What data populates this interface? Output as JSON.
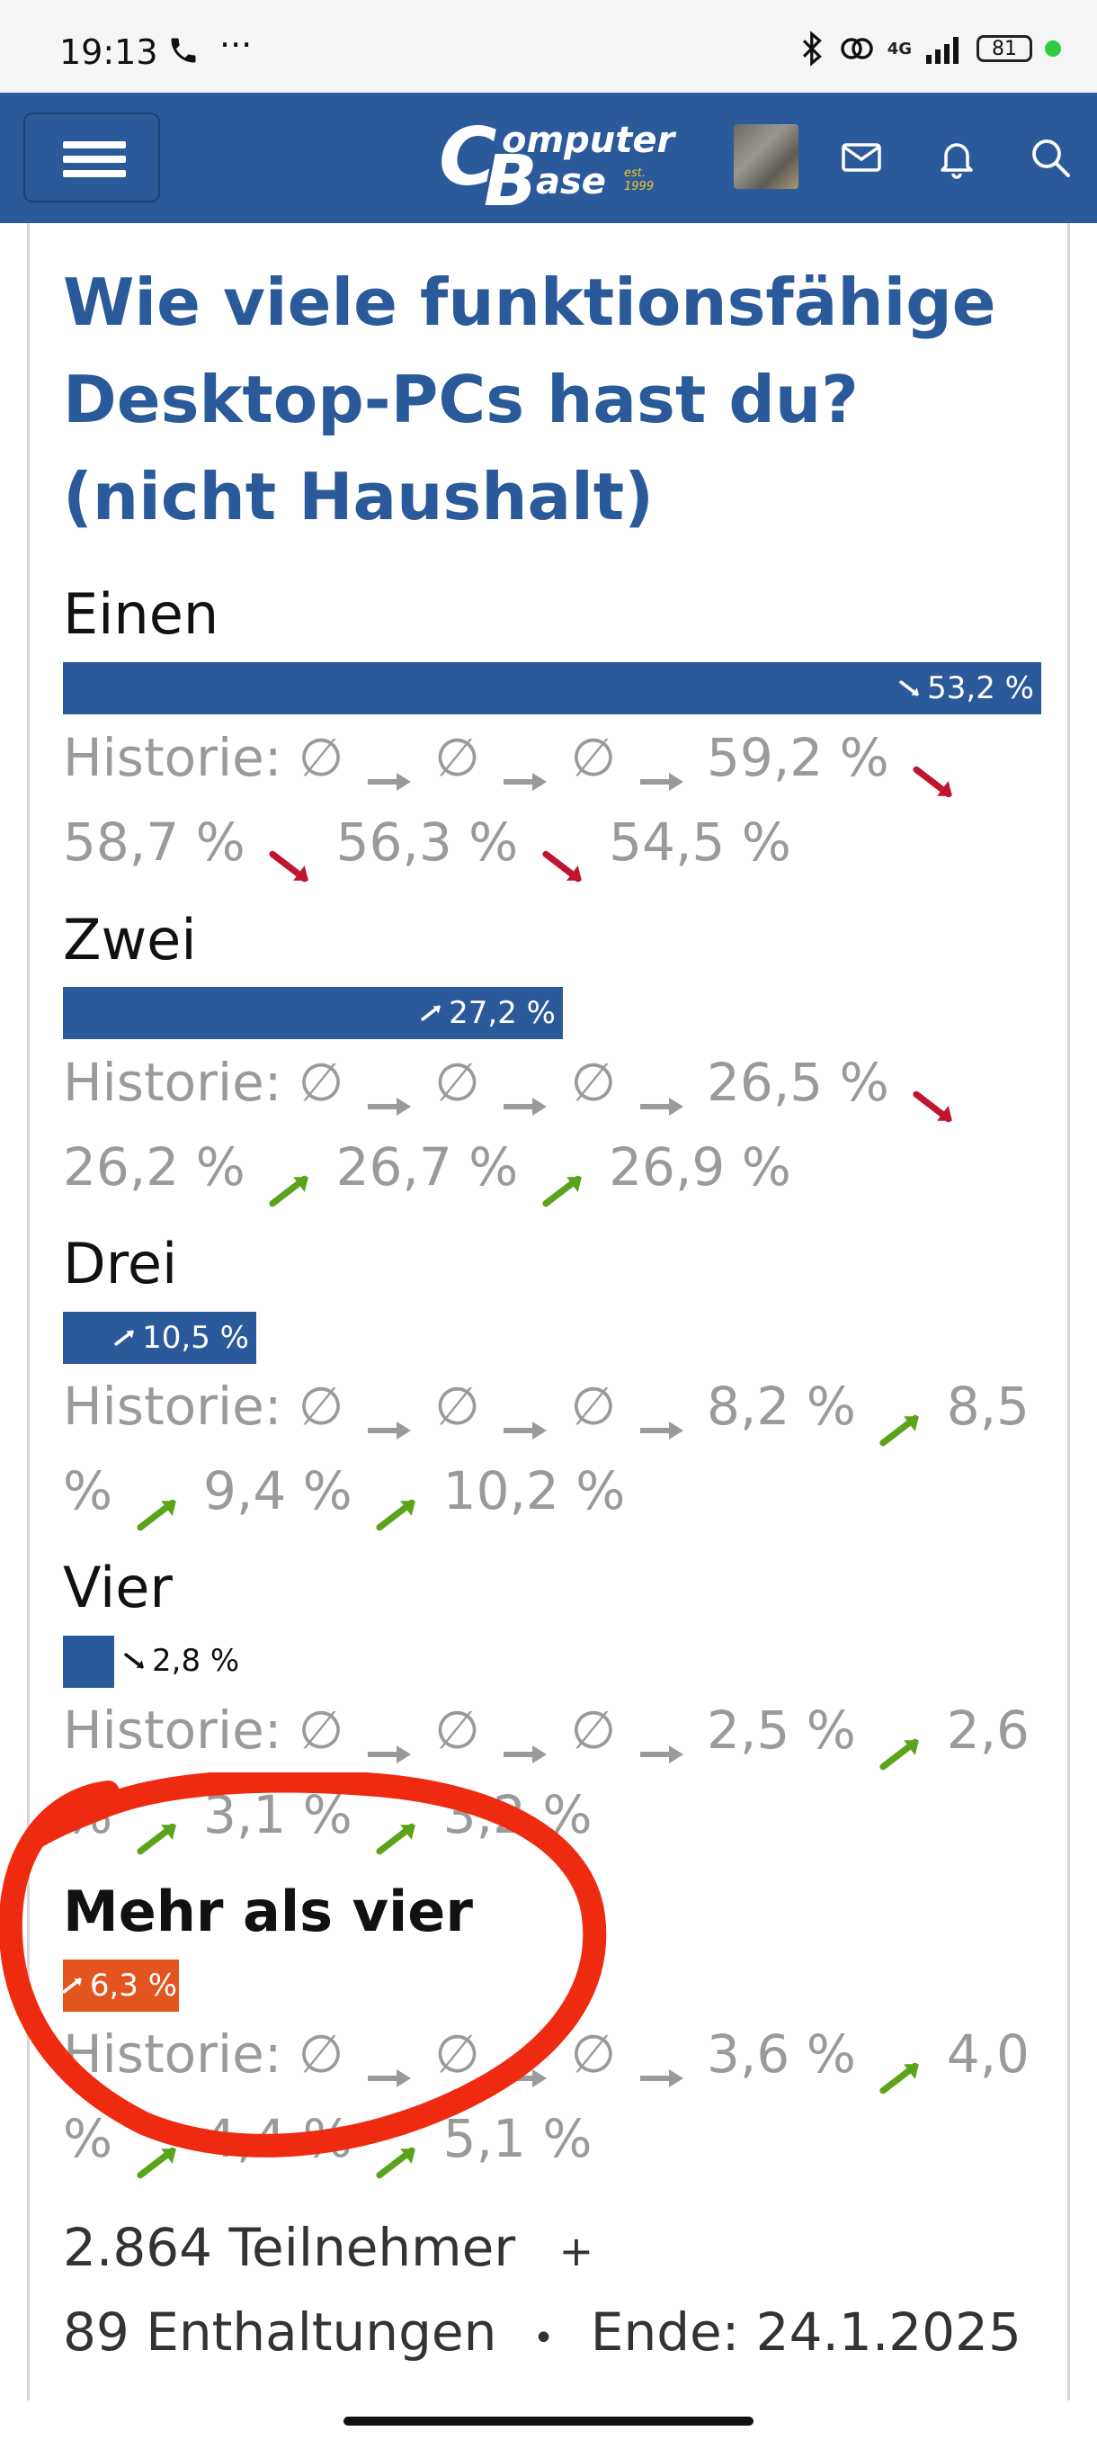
{
  "status_bar": {
    "time": "19:13",
    "dots": "···",
    "network": "4G",
    "battery": "81"
  },
  "header": {
    "logo_c": "C",
    "logo_b": "B",
    "logo_text1": "omputer",
    "logo_text2": "ase",
    "logo_est": "est. 1999",
    "icons": [
      "menu-icon",
      "avatar",
      "mail-icon",
      "bell-icon",
      "search-icon"
    ]
  },
  "poll": {
    "title": "Wie viele funktionsfähige Desktop-PCs hast du? (nicht Haushalt)",
    "options": [
      {
        "label": "Einen",
        "percent_text": "53,2 %",
        "percent": 53.2,
        "trend": "down",
        "history_prefix": "Historie:",
        "history": [
          "∅",
          "∅",
          "∅",
          "59,2 %",
          "58,7 %",
          "56,3 %",
          "54,5 %"
        ],
        "history_trends": [
          "none",
          "none",
          "none",
          "down",
          "down",
          "down"
        ]
      },
      {
        "label": "Zwei",
        "percent_text": "27,2 %",
        "percent": 27.2,
        "trend": "up",
        "history_prefix": "Historie:",
        "history": [
          "∅",
          "∅",
          "∅",
          "26,5 %",
          "26,2 %",
          "26,7 %",
          "26,9 %"
        ],
        "history_trends": [
          "none",
          "none",
          "none",
          "down",
          "up",
          "up"
        ]
      },
      {
        "label": "Drei",
        "percent_text": "10,5 %",
        "percent": 10.5,
        "trend": "up",
        "history_prefix": "Historie:",
        "history": [
          "∅",
          "∅",
          "∅",
          "8,2 %",
          "8,5 %",
          "9,4 %",
          "10,2 %"
        ],
        "history_trends": [
          "none",
          "none",
          "none",
          "up",
          "up",
          "up"
        ]
      },
      {
        "label": "Vier",
        "percent_text": "2,8 %",
        "percent": 2.8,
        "trend": "down",
        "history_prefix": "Historie:",
        "history": [
          "∅",
          "∅",
          "∅",
          "2,5 %",
          "2,6 %",
          "3,1 %",
          "3,2 %"
        ],
        "history_trends": [
          "none",
          "none",
          "none",
          "up",
          "up",
          "up"
        ]
      },
      {
        "label": "Mehr als vier",
        "percent_text": "6,3 %",
        "percent": 6.3,
        "trend": "up",
        "selected": true,
        "history_prefix": "Historie:",
        "history": [
          "∅",
          "∅",
          "∅",
          "3,6 %",
          "4,0 %",
          "4,4 %",
          "5,1 %"
        ],
        "history_trends": [
          "none",
          "none",
          "none",
          "up",
          "up",
          "up"
        ]
      }
    ],
    "participants": "2.864 Teilnehmer",
    "plus": "+",
    "abstentions": "89 Enthaltungen",
    "bullet": "•",
    "end": "Ende: 24.1.2025"
  },
  "colors": {
    "brand_blue": "#2b5a9a",
    "selected_orange": "#e4541f",
    "trend_down": "#c0152f",
    "trend_up": "#5aa31a",
    "history_gray": "#9a9a9a",
    "annotation_red": "#ee2a10"
  }
}
